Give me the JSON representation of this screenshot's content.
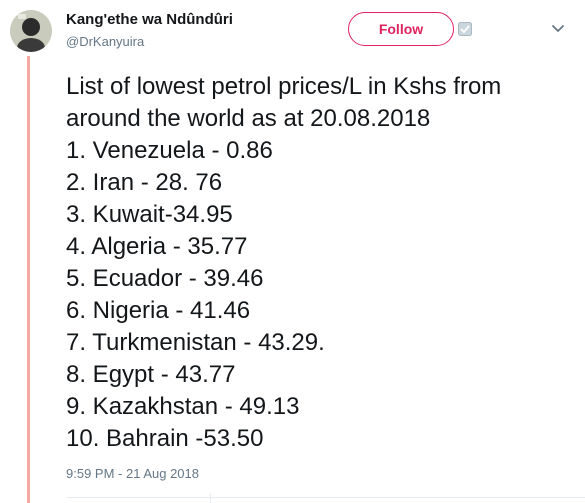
{
  "author": {
    "display_name": "Kang'ethe wa Ndûndûri",
    "handle": "@DrKanyuira",
    "avatar_icon": "profile-photo-icon"
  },
  "actions": {
    "follow_label": "Follow",
    "follow_icon": "follow-badge-icon",
    "menu_icon": "chevron-down-icon"
  },
  "tweet": {
    "intro": "List of lowest petrol prices/L in Kshs from around the world as at 20.08.2018",
    "items": [
      "1. Venezuela - 0.86",
      "2. Iran - 28. 76",
      "3. Kuwait-34.95",
      "4. Algeria - 35.77",
      "5. Ecuador - 39.46",
      "6. Nigeria - 41.46",
      "7. Turkmenistan - 43.29.",
      "8. Egypt - 43.77",
      "9. Kazakhstan - 49.13",
      "10. Bahrain -53.50"
    ],
    "timestamp": "9:59 PM - 21 Aug 2018"
  },
  "colors": {
    "accent": "#e0245e",
    "thread_line": "#f2a9a2",
    "secondary_text": "#657786",
    "primary_text": "#14171a"
  }
}
